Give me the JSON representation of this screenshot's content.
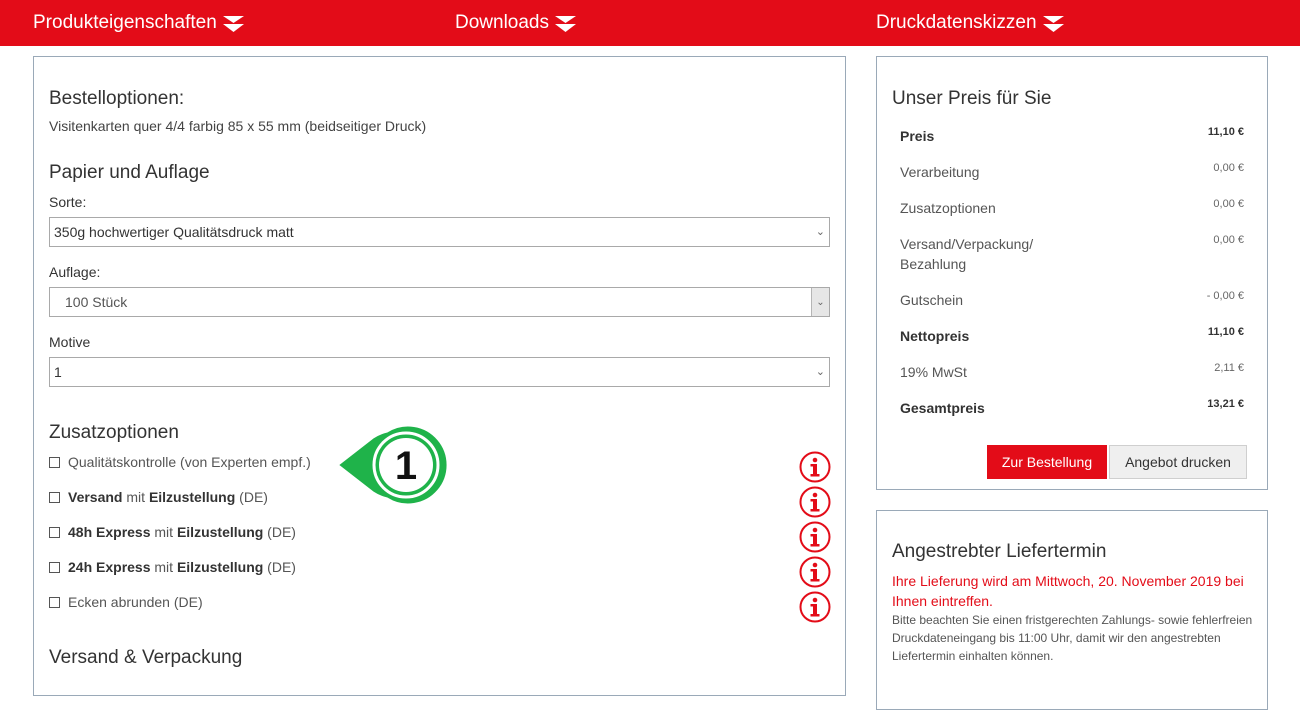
{
  "nav": {
    "items": [
      {
        "label": "Produkteigenschaften"
      },
      {
        "label": "Downloads"
      },
      {
        "label": "Druckdatenskizzen"
      }
    ],
    "bg_color": "#e30c18"
  },
  "order": {
    "heading": "Bestelloptionen:",
    "product": "Visitenkarten quer 4/4 farbig 85 x 55 mm (beidseitiger Druck)",
    "paper_section": "Papier und Auflage",
    "sorte_label": "Sorte:",
    "sorte_value": "350g hochwertiger Qualitätsdruck matt",
    "auflage_label": "Auflage:",
    "auflage_value": "100 Stück",
    "motive_label": "Motive",
    "motive_value": "1",
    "extras_section": "Zusatzoptionen",
    "extras": [
      {
        "text": "Qualitätskontrolle (von Experten empf.)"
      },
      {
        "b1": "Versand",
        "m1": " mit ",
        "b2": "Eilzustellung",
        "tail": " (DE)"
      },
      {
        "b1": "48h Express",
        "m1": " mit ",
        "b2": "Eilzustellung",
        "tail": " (DE)"
      },
      {
        "b1": "24h Express",
        "m1": " mit ",
        "b2": "Eilzustellung",
        "tail": " (DE)"
      },
      {
        "text": "Ecken abrunden (DE)"
      }
    ],
    "shipping_section": "Versand & Verpackung",
    "callout_number": "1"
  },
  "price": {
    "heading": "Unser Preis für Sie",
    "rows": [
      {
        "label": "Preis",
        "value": "11,10 €"
      },
      {
        "label": "Verarbeitung",
        "value": "0,00 €"
      },
      {
        "label": "Zusatzoptionen",
        "value": "0,00 €"
      },
      {
        "label": "Versand/Verpackung/ Bezahlung",
        "value": "0,00 €"
      },
      {
        "label": "Gutschein",
        "value": "- 0,00 €"
      },
      {
        "label": "Nettopreis",
        "value": "11,10 €"
      },
      {
        "label": "19% MwSt",
        "value": "2,11 €"
      },
      {
        "label": "Gesamtpreis",
        "value": "13,21 €"
      }
    ],
    "order_button": "Zur Bestellung",
    "quote_button": "Angebot drucken"
  },
  "delivery": {
    "heading": "Angestrebter Liefertermin",
    "highlight": "Ihre Lieferung wird am Mittwoch, 20. November 2019 bei Ihnen eintreffen.",
    "note": "Bitte beachten Sie einen fristgerechten Zahlungs- sowie fehlerfreien Druckdateneingang bis 11:00 Uhr, damit wir den angestrebten Liefertermin einhalten können."
  }
}
